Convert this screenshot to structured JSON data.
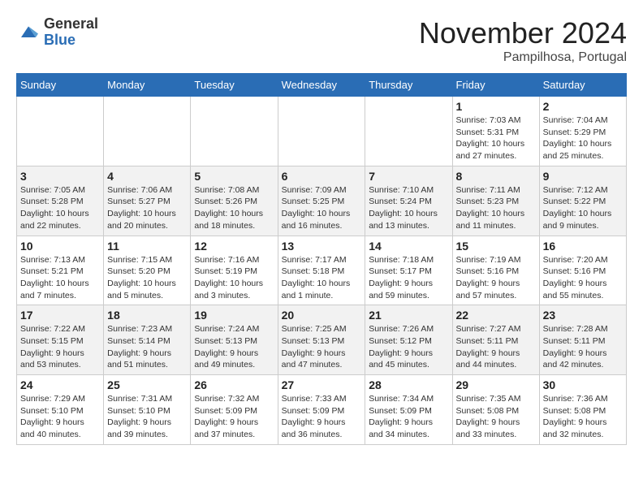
{
  "header": {
    "logo_general": "General",
    "logo_blue": "Blue",
    "title": "November 2024",
    "location": "Pampilhosa, Portugal"
  },
  "days_of_week": [
    "Sunday",
    "Monday",
    "Tuesday",
    "Wednesday",
    "Thursday",
    "Friday",
    "Saturday"
  ],
  "weeks": [
    [
      {
        "day": "",
        "info": ""
      },
      {
        "day": "",
        "info": ""
      },
      {
        "day": "",
        "info": ""
      },
      {
        "day": "",
        "info": ""
      },
      {
        "day": "",
        "info": ""
      },
      {
        "day": "1",
        "info": "Sunrise: 7:03 AM\nSunset: 5:31 PM\nDaylight: 10 hours and 27 minutes."
      },
      {
        "day": "2",
        "info": "Sunrise: 7:04 AM\nSunset: 5:29 PM\nDaylight: 10 hours and 25 minutes."
      }
    ],
    [
      {
        "day": "3",
        "info": "Sunrise: 7:05 AM\nSunset: 5:28 PM\nDaylight: 10 hours and 22 minutes."
      },
      {
        "day": "4",
        "info": "Sunrise: 7:06 AM\nSunset: 5:27 PM\nDaylight: 10 hours and 20 minutes."
      },
      {
        "day": "5",
        "info": "Sunrise: 7:08 AM\nSunset: 5:26 PM\nDaylight: 10 hours and 18 minutes."
      },
      {
        "day": "6",
        "info": "Sunrise: 7:09 AM\nSunset: 5:25 PM\nDaylight: 10 hours and 16 minutes."
      },
      {
        "day": "7",
        "info": "Sunrise: 7:10 AM\nSunset: 5:24 PM\nDaylight: 10 hours and 13 minutes."
      },
      {
        "day": "8",
        "info": "Sunrise: 7:11 AM\nSunset: 5:23 PM\nDaylight: 10 hours and 11 minutes."
      },
      {
        "day": "9",
        "info": "Sunrise: 7:12 AM\nSunset: 5:22 PM\nDaylight: 10 hours and 9 minutes."
      }
    ],
    [
      {
        "day": "10",
        "info": "Sunrise: 7:13 AM\nSunset: 5:21 PM\nDaylight: 10 hours and 7 minutes."
      },
      {
        "day": "11",
        "info": "Sunrise: 7:15 AM\nSunset: 5:20 PM\nDaylight: 10 hours and 5 minutes."
      },
      {
        "day": "12",
        "info": "Sunrise: 7:16 AM\nSunset: 5:19 PM\nDaylight: 10 hours and 3 minutes."
      },
      {
        "day": "13",
        "info": "Sunrise: 7:17 AM\nSunset: 5:18 PM\nDaylight: 10 hours and 1 minute."
      },
      {
        "day": "14",
        "info": "Sunrise: 7:18 AM\nSunset: 5:17 PM\nDaylight: 9 hours and 59 minutes."
      },
      {
        "day": "15",
        "info": "Sunrise: 7:19 AM\nSunset: 5:16 PM\nDaylight: 9 hours and 57 minutes."
      },
      {
        "day": "16",
        "info": "Sunrise: 7:20 AM\nSunset: 5:16 PM\nDaylight: 9 hours and 55 minutes."
      }
    ],
    [
      {
        "day": "17",
        "info": "Sunrise: 7:22 AM\nSunset: 5:15 PM\nDaylight: 9 hours and 53 minutes."
      },
      {
        "day": "18",
        "info": "Sunrise: 7:23 AM\nSunset: 5:14 PM\nDaylight: 9 hours and 51 minutes."
      },
      {
        "day": "19",
        "info": "Sunrise: 7:24 AM\nSunset: 5:13 PM\nDaylight: 9 hours and 49 minutes."
      },
      {
        "day": "20",
        "info": "Sunrise: 7:25 AM\nSunset: 5:13 PM\nDaylight: 9 hours and 47 minutes."
      },
      {
        "day": "21",
        "info": "Sunrise: 7:26 AM\nSunset: 5:12 PM\nDaylight: 9 hours and 45 minutes."
      },
      {
        "day": "22",
        "info": "Sunrise: 7:27 AM\nSunset: 5:11 PM\nDaylight: 9 hours and 44 minutes."
      },
      {
        "day": "23",
        "info": "Sunrise: 7:28 AM\nSunset: 5:11 PM\nDaylight: 9 hours and 42 minutes."
      }
    ],
    [
      {
        "day": "24",
        "info": "Sunrise: 7:29 AM\nSunset: 5:10 PM\nDaylight: 9 hours and 40 minutes."
      },
      {
        "day": "25",
        "info": "Sunrise: 7:31 AM\nSunset: 5:10 PM\nDaylight: 9 hours and 39 minutes."
      },
      {
        "day": "26",
        "info": "Sunrise: 7:32 AM\nSunset: 5:09 PM\nDaylight: 9 hours and 37 minutes."
      },
      {
        "day": "27",
        "info": "Sunrise: 7:33 AM\nSunset: 5:09 PM\nDaylight: 9 hours and 36 minutes."
      },
      {
        "day": "28",
        "info": "Sunrise: 7:34 AM\nSunset: 5:09 PM\nDaylight: 9 hours and 34 minutes."
      },
      {
        "day": "29",
        "info": "Sunrise: 7:35 AM\nSunset: 5:08 PM\nDaylight: 9 hours and 33 minutes."
      },
      {
        "day": "30",
        "info": "Sunrise: 7:36 AM\nSunset: 5:08 PM\nDaylight: 9 hours and 32 minutes."
      }
    ]
  ]
}
